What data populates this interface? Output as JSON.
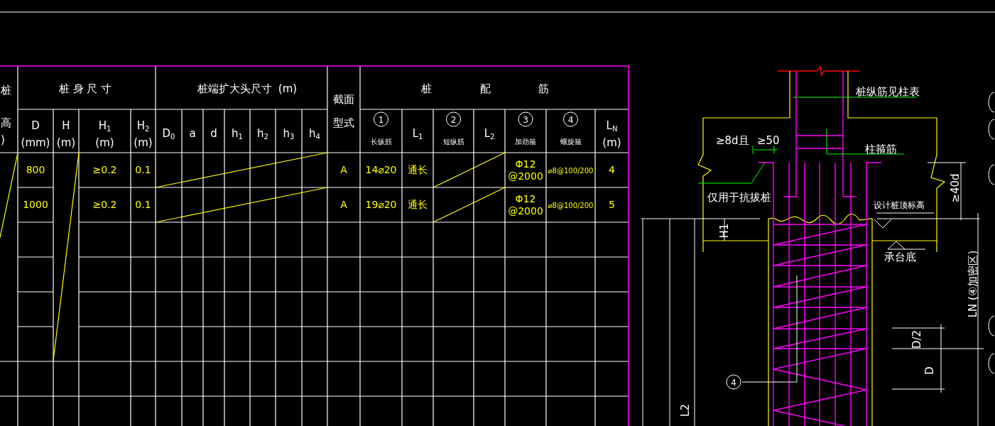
{
  "table": {
    "left_header": [
      "桩",
      "高",
      ")"
    ],
    "group_headers": [
      {
        "text": "桩 身 尺 寸"
      },
      {
        "text": "桩端扩大头尺寸"
      },
      {
        "text": "(m)"
      },
      {
        "text": "截面",
        "text2": "型式"
      },
      {
        "text": "桩"
      },
      {
        "text": "配"
      },
      {
        "text": "筋"
      }
    ],
    "columns": [
      {
        "label": "D",
        "unit": "(mm)"
      },
      {
        "label": "H",
        "unit": "(m)"
      },
      {
        "label": "H",
        "sub": "1",
        "unit": "(m)"
      },
      {
        "label": "H",
        "sub": "2",
        "unit": "(m)"
      },
      {
        "label": "D",
        "sub": "0"
      },
      {
        "label": "a"
      },
      {
        "label": "d"
      },
      {
        "label": "h",
        "sub": "1"
      },
      {
        "label": "h",
        "sub": "2"
      },
      {
        "label": "h",
        "sub": "3"
      },
      {
        "label": "h",
        "sub": "4"
      },
      {
        "number": "1",
        "label": "长纵筋"
      },
      {
        "label": "L",
        "sub": "1"
      },
      {
        "number": "2",
        "label": "短纵筋"
      },
      {
        "label": "L",
        "sub": "2"
      },
      {
        "number": "3",
        "label": "加劲箍"
      },
      {
        "number": "4",
        "label": "螺旋箍"
      },
      {
        "label": "L",
        "sub": "N",
        "unit": "(m)"
      }
    ],
    "rows": [
      {
        "D": "800",
        "H1": "≥0.2",
        "H2": "0.1",
        "section": "A",
        "long_bar": "14⌀20",
        "L1": "通长",
        "stiffening_hoop": [
          "Φ12",
          "@2000"
        ],
        "spiral_hoop": "⌀8@100/200",
        "LN": "4"
      },
      {
        "D": "1000",
        "H1": "≥0.2",
        "H2": "0.1",
        "section": "A",
        "long_bar": "19⌀20",
        "L1": "通长",
        "stiffening_hoop": [
          "Φ12",
          "@2000"
        ],
        "spiral_hoop": "⌀8@100/200",
        "LN": "5"
      }
    ]
  },
  "detail": {
    "labels": [
      "桩纵筋见柱表",
      "≥8d且",
      "≥50",
      "柱箍筋",
      "仅用于抗拔桩",
      "设计桩顶标高",
      "承台底"
    ],
    "rotated_labels": [
      "≥40d",
      "H1",
      "LN (④加密区)",
      "D/2",
      "D",
      "L2"
    ],
    "callout": "4"
  }
}
